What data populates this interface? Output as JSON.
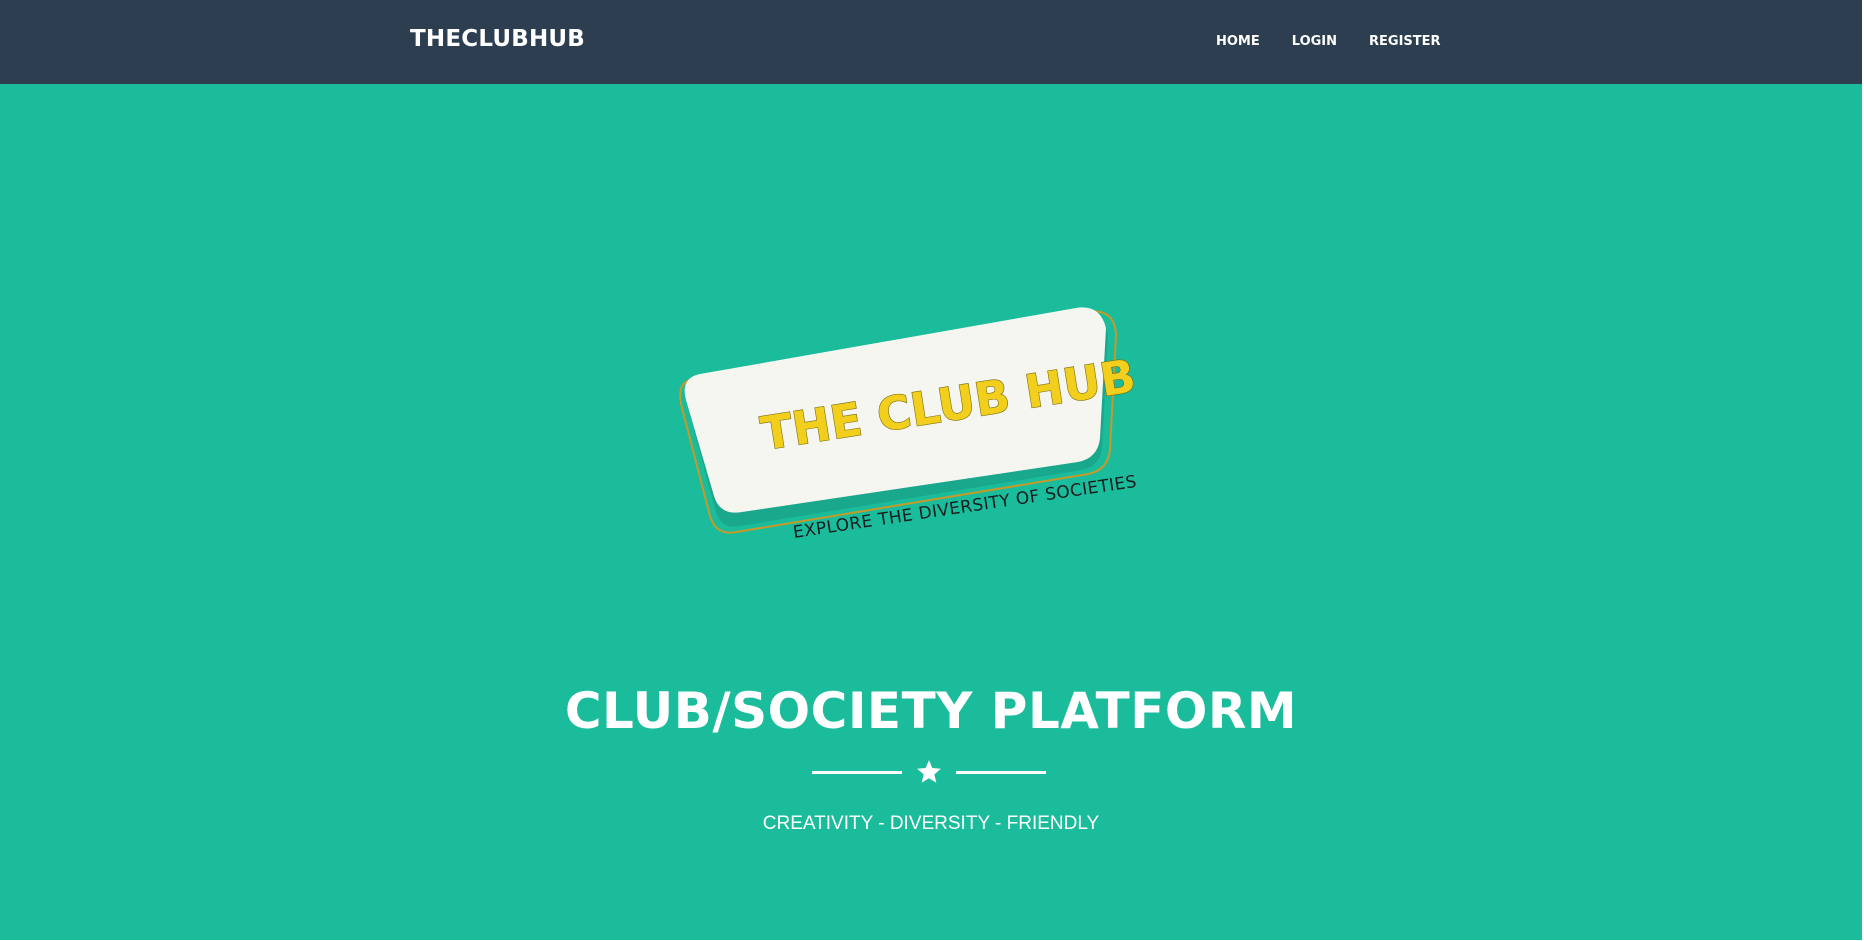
{
  "navbar": {
    "brand": "THECLUBHUB",
    "links": [
      {
        "label": "HOME"
      },
      {
        "label": "LOGIN"
      },
      {
        "label": "REGISTER"
      }
    ]
  },
  "logo": {
    "title": "THE CLUB HUB",
    "tagline": "EXPLORE THE DIVERSITY OF SOCIETIES"
  },
  "hero": {
    "title": "CLUB/SOCIETY PLATFORM",
    "divider_icon": "star-icon",
    "subtitle": "CREATIVITY - DIVERSITY - FRIENDLY"
  },
  "colors": {
    "navbar_bg": "#2c3e50",
    "page_bg": "#1abc9c",
    "logo_card": "#f6f6f1",
    "logo_text": "#f2cf1d",
    "logo_outline": "#c59a2a"
  }
}
